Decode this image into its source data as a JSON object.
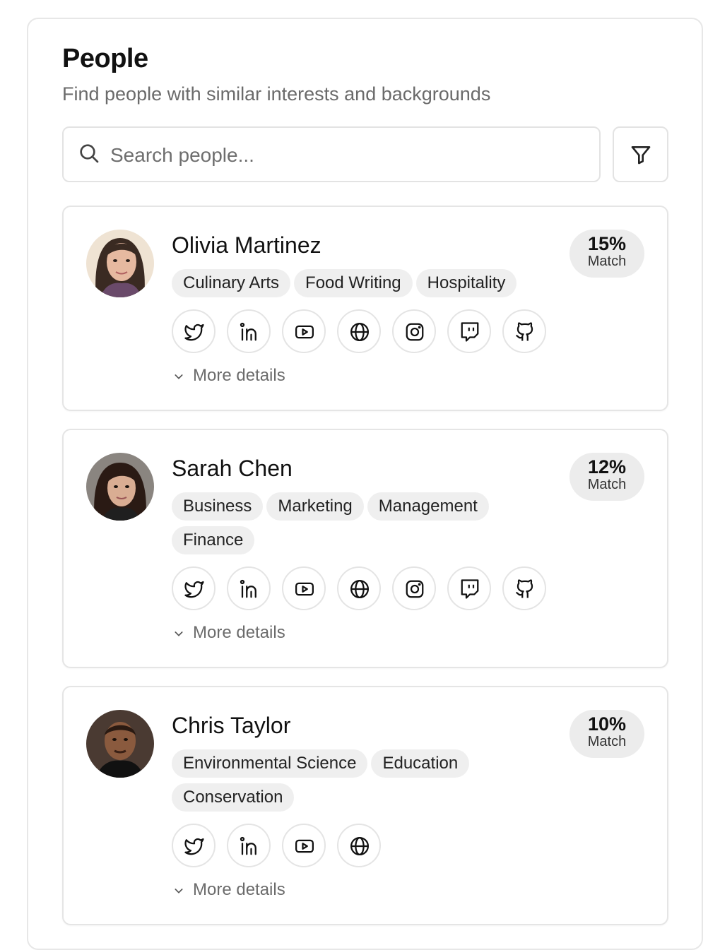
{
  "header": {
    "title": "People",
    "subtitle": "Find people with similar interests and backgrounds"
  },
  "search": {
    "placeholder": "Search people...",
    "icon": "search-icon"
  },
  "filter": {
    "icon": "filter-icon"
  },
  "people": [
    {
      "name": "Olivia Martinez",
      "match_pct": "15%",
      "match_label": "Match",
      "tags": [
        "Culinary Arts",
        "Food Writing",
        "Hospitality"
      ],
      "socials": [
        "twitter-icon",
        "linkedin-icon",
        "youtube-icon",
        "globe-icon",
        "instagram-icon",
        "twitch-icon",
        "github-icon"
      ],
      "more": "More details"
    },
    {
      "name": "Sarah Chen",
      "match_pct": "12%",
      "match_label": "Match",
      "tags": [
        "Business",
        "Marketing",
        "Management",
        "Finance"
      ],
      "socials": [
        "twitter-icon",
        "linkedin-icon",
        "youtube-icon",
        "globe-icon",
        "instagram-icon",
        "twitch-icon",
        "github-icon"
      ],
      "more": "More details"
    },
    {
      "name": "Chris Taylor",
      "match_pct": "10%",
      "match_label": "Match",
      "tags": [
        "Environmental Science",
        "Education",
        "Conservation"
      ],
      "socials": [
        "twitter-icon",
        "linkedin-icon",
        "youtube-icon",
        "globe-icon"
      ],
      "more": "More details"
    }
  ]
}
